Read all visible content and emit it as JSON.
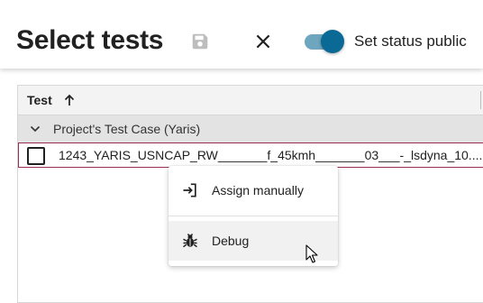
{
  "header": {
    "title": "Select tests",
    "save_icon": "save-icon",
    "close_icon": "close-icon",
    "toggle_label": "Set status public",
    "toggle_on": true
  },
  "table": {
    "column_header": "Test",
    "sort_icon": "arrow-up-icon",
    "group": {
      "label": "Project's Test Case (Yaris)",
      "expanded": true
    },
    "rows": [
      {
        "name": "1243_YARIS_USNCAP_RW_______f_45kmh_______03___-_lsdyna_10....",
        "checked": false
      }
    ]
  },
  "context_menu": {
    "items": [
      {
        "label": "Assign manually",
        "icon": "assign-arrow-icon"
      },
      {
        "label": "Debug",
        "icon": "bug-icon"
      }
    ]
  },
  "colors": {
    "accent": "#0b6996",
    "toggle_track": "#6fa6bf",
    "selected_row_border": "#9b2f4f",
    "group_background": "#e3e3e3",
    "header_background": "#f3f3f3"
  }
}
